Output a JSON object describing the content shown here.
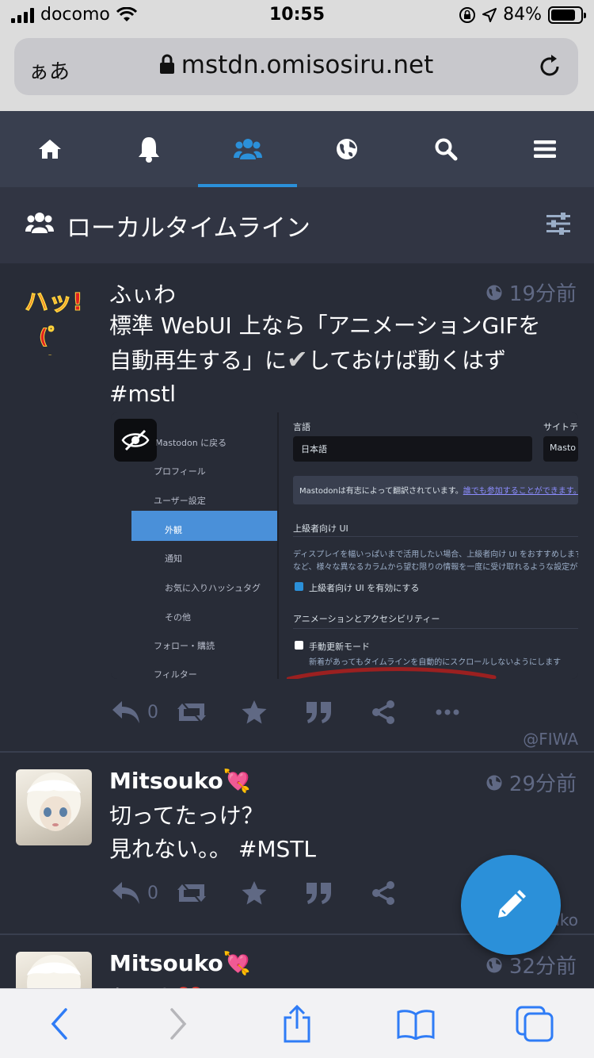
{
  "statusbar": {
    "carrier": "docomo",
    "time": "10:55",
    "battery": "84%",
    "battery_level": 0.84
  },
  "browser": {
    "aa_label": "ぁあ",
    "url": "mstdn.omisosiru.net"
  },
  "nav": {
    "items": [
      "home",
      "notifications",
      "local",
      "federated",
      "search",
      "menu"
    ],
    "active": "local"
  },
  "column": {
    "title": "ローカルタイムライン"
  },
  "statuses": [
    {
      "display_name": "ふぃわ",
      "avatar_text": "ハッ!",
      "avatar_text2": "(゜д゜)",
      "time": "19分前",
      "content_line1": "標準 WebUI 上なら「アニメーションGIFを",
      "content_line2a": "自動再生する」に",
      "content_check": "✔",
      "content_line2b": "しておけば動くはず",
      "content_line3": "#mstl",
      "replies": "0",
      "handle": "@FIWA",
      "media": {
        "side_items": [
          "Mastodon に戻る",
          "プロフィール",
          "ユーザー設定",
          "外観",
          "通知",
          "お気に入りハッシュタグ",
          "その他",
          "フォロー・購読",
          "フィルター"
        ],
        "lang_label": "言語",
        "lang_value": "日本語",
        "theme_label": "サイトテー",
        "theme_value": "Masto",
        "notice_text": "Mastodonは有志によって翻訳されています。",
        "notice_link": "誰でも参加することができます。",
        "advanced_header": "上級者向け UI",
        "advanced_desc1": "ディスプレイを幅いっぱいまで活用したい場合、上級者向け UI をおすすめします。ホ",
        "advanced_desc2": "など、様々な異なるカラムから望む限りの情報を一度に受け取れるような設定が可",
        "advanced_check": "上級者向け UI を有効にする",
        "anim_header": "アニメーションとアクセシビリティー",
        "manual_label": "手動更新モード",
        "manual_desc": "新着があってもタイムラインを自動的にスクロールしないようにします"
      }
    },
    {
      "display_name": "Mitsouko",
      "display_emoji": "💘",
      "time": "29分前",
      "content_line1": "切ってたっけ？",
      "content_line2": "見れない。。 #MSTL",
      "replies": "0",
      "handle": "@Mitsouko"
    },
    {
      "display_name": "Mitsouko",
      "display_emoji": "💘",
      "time": "32分前",
      "content_partial": "おはよ❤️ #MSTL"
    }
  ],
  "colors": {
    "background": "#282c37",
    "nav_bg": "#393f4f",
    "accent": "#2b90d9",
    "muted": "#606984"
  }
}
